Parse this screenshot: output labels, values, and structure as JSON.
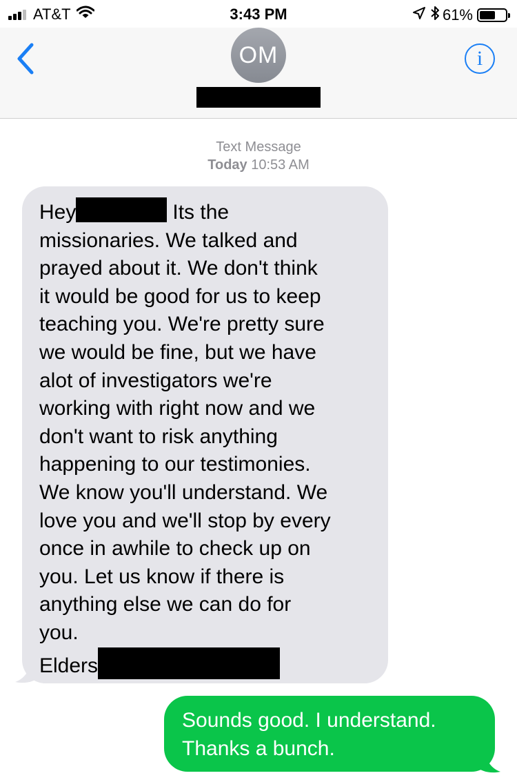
{
  "status_bar": {
    "carrier": "AT&T",
    "time": "3:43 PM",
    "battery": "61%",
    "battery_level": 0.61,
    "icons": [
      "signal-icon",
      "wifi-icon",
      "location-icon",
      "bluetooth-icon",
      "battery-icon"
    ]
  },
  "header": {
    "avatar_initials": "OM",
    "back_icon": "chevron-left-icon",
    "info_icon": "info-icon",
    "info_glyph": "i",
    "accent_color": "#1a7ff5"
  },
  "conversation": {
    "service": "Text Message",
    "day": "Today",
    "time": "10:53 AM"
  },
  "messages": {
    "incoming": {
      "color": "#e5e5ea",
      "greeting": "Hey",
      "first_line_rest": "Its the",
      "lines": [
        "missionaries. We talked and",
        "prayed about it. We don't think",
        "it would be good for us to keep",
        "teaching you. We're pretty sure",
        "we would be fine, but we have",
        "alot of investigators we're",
        "working with right now and we",
        "don't want to risk anything",
        "happening to our testimonies.",
        "We know you'll understand. We",
        "love you and we'll stop by every",
        "once in awhile to check up on",
        "you. Let us know if there is",
        "anything else we can do for",
        "you."
      ],
      "signoff": "Elders"
    },
    "outgoing": {
      "color": "#0ac54a",
      "lines": [
        "Sounds good. I understand.",
        "Thanks a bunch."
      ]
    }
  }
}
